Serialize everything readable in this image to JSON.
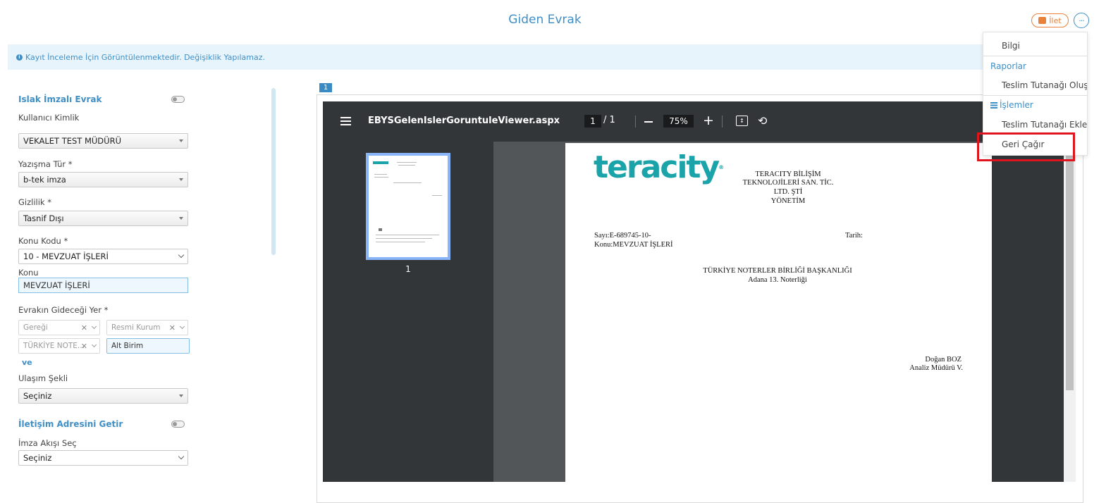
{
  "header": {
    "title": "Giden Evrak",
    "ilet_label": "İlet",
    "more_label": "···"
  },
  "info_bar": {
    "icon": "info-circle-icon",
    "text": "Kayıt İnceleme İçin Görüntülenmektedir. Değişiklik Yapılamaz."
  },
  "menu": {
    "bilgi": "Bilgi",
    "raporlar_header": "Raporlar",
    "teslim_olustur": "Teslim Tutanağı Oluştur",
    "islemler_header": "İşlemler",
    "teslim_ekle": "Teslim Tutanağı Ekle",
    "geri_cagir": "Geri Çağır"
  },
  "form": {
    "islak_imzali": "Islak İmzalı Evrak",
    "kullanici_kimlik_label": "Kullanıcı Kimlik",
    "kullanici_kimlik_value": "VEKALET TEST MÜDÜRÜ",
    "yazisma_tur_label": "Yazışma Tür *",
    "yazisma_tur_value": "b-tek imza",
    "gizlilik_label": "Gizlilik *",
    "gizlilik_value": "Tasnif Dışı",
    "konu_kodu_label": "Konu Kodu *",
    "konu_kodu_value": "10 - MEVZUAT İŞLERİ",
    "konu_label": "Konu",
    "konu_value": "MEVZUAT İŞLERİ",
    "gidecegi_yer_label": "Evrakın Gideceği Yer *",
    "geregi": "Gereği",
    "resmi_kurum": "Resmi Kurum",
    "turkiye_note": "TÜRKİYE NOTE...",
    "alt_birim": "Alt Birim",
    "ve_link": "ve",
    "ulasim_label": "Ulaşım Şekli",
    "ulasim_value": "Seçiniz",
    "iletisim_adresi": "İletişim Adresini Getir",
    "imza_akisi_label": "İmza Akışı Seç",
    "imza_akisi_value": "Seçiniz"
  },
  "viewer": {
    "page_badge": "1",
    "filename": "EBYSGelenIslerGoruntuleViewer.aspx",
    "current_page": "1",
    "total_pages": "/  1",
    "zoom": "75%",
    "thumb_number": "1",
    "document": {
      "logo_text": "teracity",
      "logo_mark": "®",
      "company_line1": "TERACITY BİLİŞİM",
      "company_line2": "TEKNOLOJİLERİ SAN. TİC.",
      "company_line3": "LTD. ŞTİ",
      "company_line4": "YÖNETİM",
      "sayi": "Sayı:E-689745-10-",
      "tarih": "Tarih:",
      "konu": "Konu:MEVZUAT İŞLERİ",
      "recipient_line1": "TÜRKİYE NOTERLER BİRLİĞİ BAŞKANLIĞI",
      "recipient_line2": "Adana 13. Noterliği",
      "signer_name": "Doğan BOZ",
      "signer_title": "Analiz Müdürü V."
    }
  }
}
